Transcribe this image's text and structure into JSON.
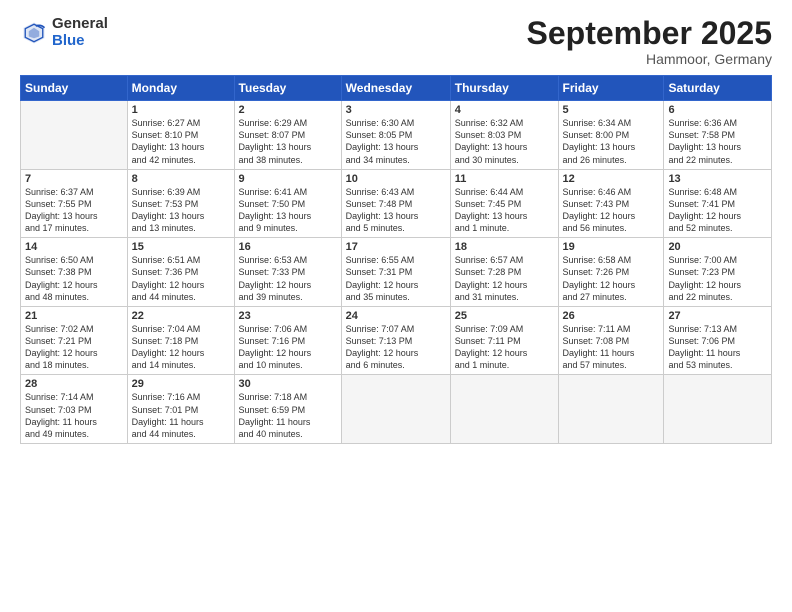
{
  "logo": {
    "general": "General",
    "blue": "Blue"
  },
  "header": {
    "month": "September 2025",
    "location": "Hammoor, Germany"
  },
  "weekdays": [
    "Sunday",
    "Monday",
    "Tuesday",
    "Wednesday",
    "Thursday",
    "Friday",
    "Saturday"
  ],
  "weeks": [
    [
      {
        "day": "",
        "info": ""
      },
      {
        "day": "1",
        "info": "Sunrise: 6:27 AM\nSunset: 8:10 PM\nDaylight: 13 hours\nand 42 minutes."
      },
      {
        "day": "2",
        "info": "Sunrise: 6:29 AM\nSunset: 8:07 PM\nDaylight: 13 hours\nand 38 minutes."
      },
      {
        "day": "3",
        "info": "Sunrise: 6:30 AM\nSunset: 8:05 PM\nDaylight: 13 hours\nand 34 minutes."
      },
      {
        "day": "4",
        "info": "Sunrise: 6:32 AM\nSunset: 8:03 PM\nDaylight: 13 hours\nand 30 minutes."
      },
      {
        "day": "5",
        "info": "Sunrise: 6:34 AM\nSunset: 8:00 PM\nDaylight: 13 hours\nand 26 minutes."
      },
      {
        "day": "6",
        "info": "Sunrise: 6:36 AM\nSunset: 7:58 PM\nDaylight: 13 hours\nand 22 minutes."
      }
    ],
    [
      {
        "day": "7",
        "info": "Sunrise: 6:37 AM\nSunset: 7:55 PM\nDaylight: 13 hours\nand 17 minutes."
      },
      {
        "day": "8",
        "info": "Sunrise: 6:39 AM\nSunset: 7:53 PM\nDaylight: 13 hours\nand 13 minutes."
      },
      {
        "day": "9",
        "info": "Sunrise: 6:41 AM\nSunset: 7:50 PM\nDaylight: 13 hours\nand 9 minutes."
      },
      {
        "day": "10",
        "info": "Sunrise: 6:43 AM\nSunset: 7:48 PM\nDaylight: 13 hours\nand 5 minutes."
      },
      {
        "day": "11",
        "info": "Sunrise: 6:44 AM\nSunset: 7:45 PM\nDaylight: 13 hours\nand 1 minute."
      },
      {
        "day": "12",
        "info": "Sunrise: 6:46 AM\nSunset: 7:43 PM\nDaylight: 12 hours\nand 56 minutes."
      },
      {
        "day": "13",
        "info": "Sunrise: 6:48 AM\nSunset: 7:41 PM\nDaylight: 12 hours\nand 52 minutes."
      }
    ],
    [
      {
        "day": "14",
        "info": "Sunrise: 6:50 AM\nSunset: 7:38 PM\nDaylight: 12 hours\nand 48 minutes."
      },
      {
        "day": "15",
        "info": "Sunrise: 6:51 AM\nSunset: 7:36 PM\nDaylight: 12 hours\nand 44 minutes."
      },
      {
        "day": "16",
        "info": "Sunrise: 6:53 AM\nSunset: 7:33 PM\nDaylight: 12 hours\nand 39 minutes."
      },
      {
        "day": "17",
        "info": "Sunrise: 6:55 AM\nSunset: 7:31 PM\nDaylight: 12 hours\nand 35 minutes."
      },
      {
        "day": "18",
        "info": "Sunrise: 6:57 AM\nSunset: 7:28 PM\nDaylight: 12 hours\nand 31 minutes."
      },
      {
        "day": "19",
        "info": "Sunrise: 6:58 AM\nSunset: 7:26 PM\nDaylight: 12 hours\nand 27 minutes."
      },
      {
        "day": "20",
        "info": "Sunrise: 7:00 AM\nSunset: 7:23 PM\nDaylight: 12 hours\nand 22 minutes."
      }
    ],
    [
      {
        "day": "21",
        "info": "Sunrise: 7:02 AM\nSunset: 7:21 PM\nDaylight: 12 hours\nand 18 minutes."
      },
      {
        "day": "22",
        "info": "Sunrise: 7:04 AM\nSunset: 7:18 PM\nDaylight: 12 hours\nand 14 minutes."
      },
      {
        "day": "23",
        "info": "Sunrise: 7:06 AM\nSunset: 7:16 PM\nDaylight: 12 hours\nand 10 minutes."
      },
      {
        "day": "24",
        "info": "Sunrise: 7:07 AM\nSunset: 7:13 PM\nDaylight: 12 hours\nand 6 minutes."
      },
      {
        "day": "25",
        "info": "Sunrise: 7:09 AM\nSunset: 7:11 PM\nDaylight: 12 hours\nand 1 minute."
      },
      {
        "day": "26",
        "info": "Sunrise: 7:11 AM\nSunset: 7:08 PM\nDaylight: 11 hours\nand 57 minutes."
      },
      {
        "day": "27",
        "info": "Sunrise: 7:13 AM\nSunset: 7:06 PM\nDaylight: 11 hours\nand 53 minutes."
      }
    ],
    [
      {
        "day": "28",
        "info": "Sunrise: 7:14 AM\nSunset: 7:03 PM\nDaylight: 11 hours\nand 49 minutes."
      },
      {
        "day": "29",
        "info": "Sunrise: 7:16 AM\nSunset: 7:01 PM\nDaylight: 11 hours\nand 44 minutes."
      },
      {
        "day": "30",
        "info": "Sunrise: 7:18 AM\nSunset: 6:59 PM\nDaylight: 11 hours\nand 40 minutes."
      },
      {
        "day": "",
        "info": ""
      },
      {
        "day": "",
        "info": ""
      },
      {
        "day": "",
        "info": ""
      },
      {
        "day": "",
        "info": ""
      }
    ]
  ]
}
